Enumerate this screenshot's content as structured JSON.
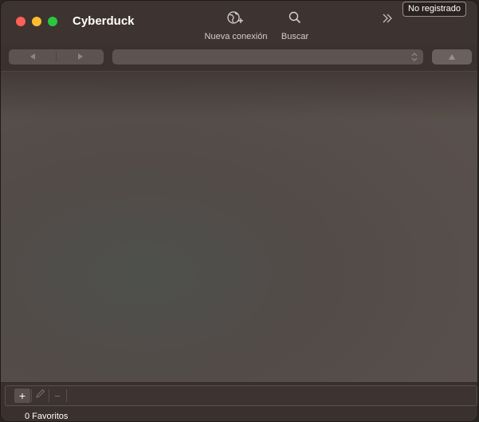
{
  "window": {
    "title": "Cyberduck"
  },
  "toolbar": {
    "new_connection_label": "Nueva conexión",
    "search_label": "Buscar",
    "unregistered_label": "No registrado",
    "icons": {
      "new_connection": "globe-plus-icon",
      "search": "magnifier-icon",
      "overflow": "double-chevron-right-icon"
    }
  },
  "navigation": {
    "back_icon": "triangle-left-icon",
    "forward_icon": "triangle-right-icon",
    "path_value": "",
    "parent_icon": "triangle-up-icon"
  },
  "bookmarks": {
    "add_label": "+",
    "remove_label": "−",
    "edit_icon": "pencil-icon",
    "status": "0 Favoritos"
  },
  "colors": {
    "close": "#ff5f57",
    "minimize": "#febc2e",
    "zoom": "#28c840",
    "window_bg": "#3a302c",
    "content_bg": "#574f4c"
  }
}
